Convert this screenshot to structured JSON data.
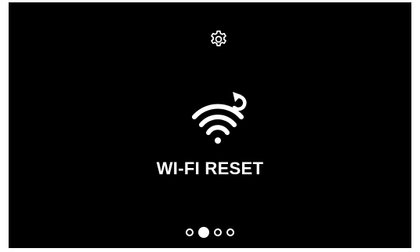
{
  "screen": {
    "title": "WI-FI RESET",
    "background_color": "#000000",
    "foreground_color": "#ffffff"
  },
  "icons": {
    "settings": "gear-icon",
    "main": "wifi-reset-icon"
  },
  "pagination": {
    "total": 4,
    "active_index": 1
  }
}
